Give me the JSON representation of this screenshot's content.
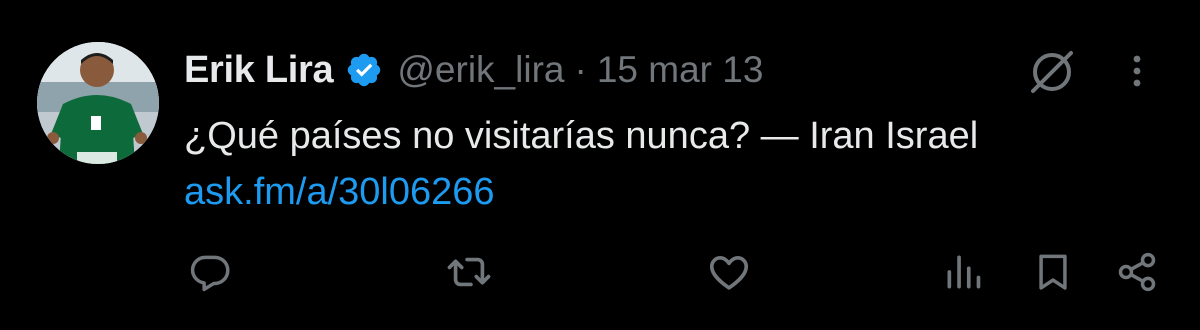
{
  "tweet": {
    "display_name": "Erik Lira",
    "handle": "@erik_lira",
    "separator": "·",
    "timestamp": "15 mar 13",
    "text": "¿Qué países no visitarías nunca? — Iran Israel",
    "link": "ask.fm/a/30l06266",
    "verified": true
  },
  "icons": {
    "verified": "verified-badge-icon",
    "grok": "grok-icon",
    "more": "more-vertical-icon",
    "reply": "reply-icon",
    "retweet": "retweet-icon",
    "like": "heart-icon",
    "views": "views-chart-icon",
    "bookmark": "bookmark-icon",
    "share": "share-icon"
  },
  "colors": {
    "background": "#000000",
    "text_primary": "#e7e9ea",
    "text_secondary": "#71767b",
    "link": "#1d9bf0",
    "verified": "#1d9bf0"
  }
}
